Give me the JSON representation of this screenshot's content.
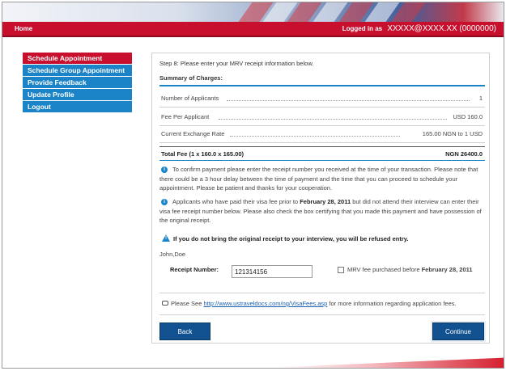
{
  "nav": {
    "home_label": "Home",
    "logged_in_label": "Logged in as",
    "user_id": "XXXXX@XXXX.XX (0000000)"
  },
  "sidebar": {
    "items": [
      {
        "label": "Schedule Appointment",
        "active": true
      },
      {
        "label": "Schedule Group Appointment",
        "active": false
      },
      {
        "label": "Provide Feedback",
        "active": false
      },
      {
        "label": "Update Profile",
        "active": false
      },
      {
        "label": "Logout",
        "active": false
      }
    ]
  },
  "main": {
    "step_prefix": "Step 8:",
    "step_text": "Please enter your MRV receipt information below.",
    "summary_title": "Summary of Charges:",
    "charges": [
      {
        "label": "Number of Applicants",
        "value": "1"
      },
      {
        "label": "Fee Per Applicant",
        "value": "USD 160.0"
      },
      {
        "label": "Current Exchange Rate",
        "value": "165.00 NGN to 1 USD"
      }
    ],
    "total_label": "Total Fee (1 x 160.0 x 165.00)",
    "total_value": "NGN 26400.0",
    "info1": "To confirm payment please enter the receipt number you received at the time of your transaction. Please note that there could be a 3 hour delay between the time of payment and the time that you can proceed to schedule your appointment. Please be patient and thanks for your cooperation.",
    "info2_part1": "Applicants who have paid their visa fee prior to",
    "info2_date": "February 28, 2011",
    "info2_part2": "but did not attend their interview can enter their visa fee receipt number below. Please also check the box certifying that you made this payment and have possession of the original receipt.",
    "warning": "If you do not bring the original receipt to your interview, you will be refused entry.",
    "applicant_name": "John,Doe",
    "receipt_label": "Receipt Number:",
    "receipt_value": "121314156",
    "mrv_label_part1": "MRV fee purchased before",
    "mrv_label_date": "February 28, 2011",
    "please_see": "Please See",
    "link_text": "http://www.ustraveldocs.com/ng/VisaFees.asp",
    "please_see_after": "for more information regarding application fees.",
    "back_label": "Back",
    "continue_label": "Continue"
  },
  "colors": {
    "brand_red": "#c8102e",
    "brand_blue": "#1b84c9",
    "button_blue": "#12518f"
  }
}
